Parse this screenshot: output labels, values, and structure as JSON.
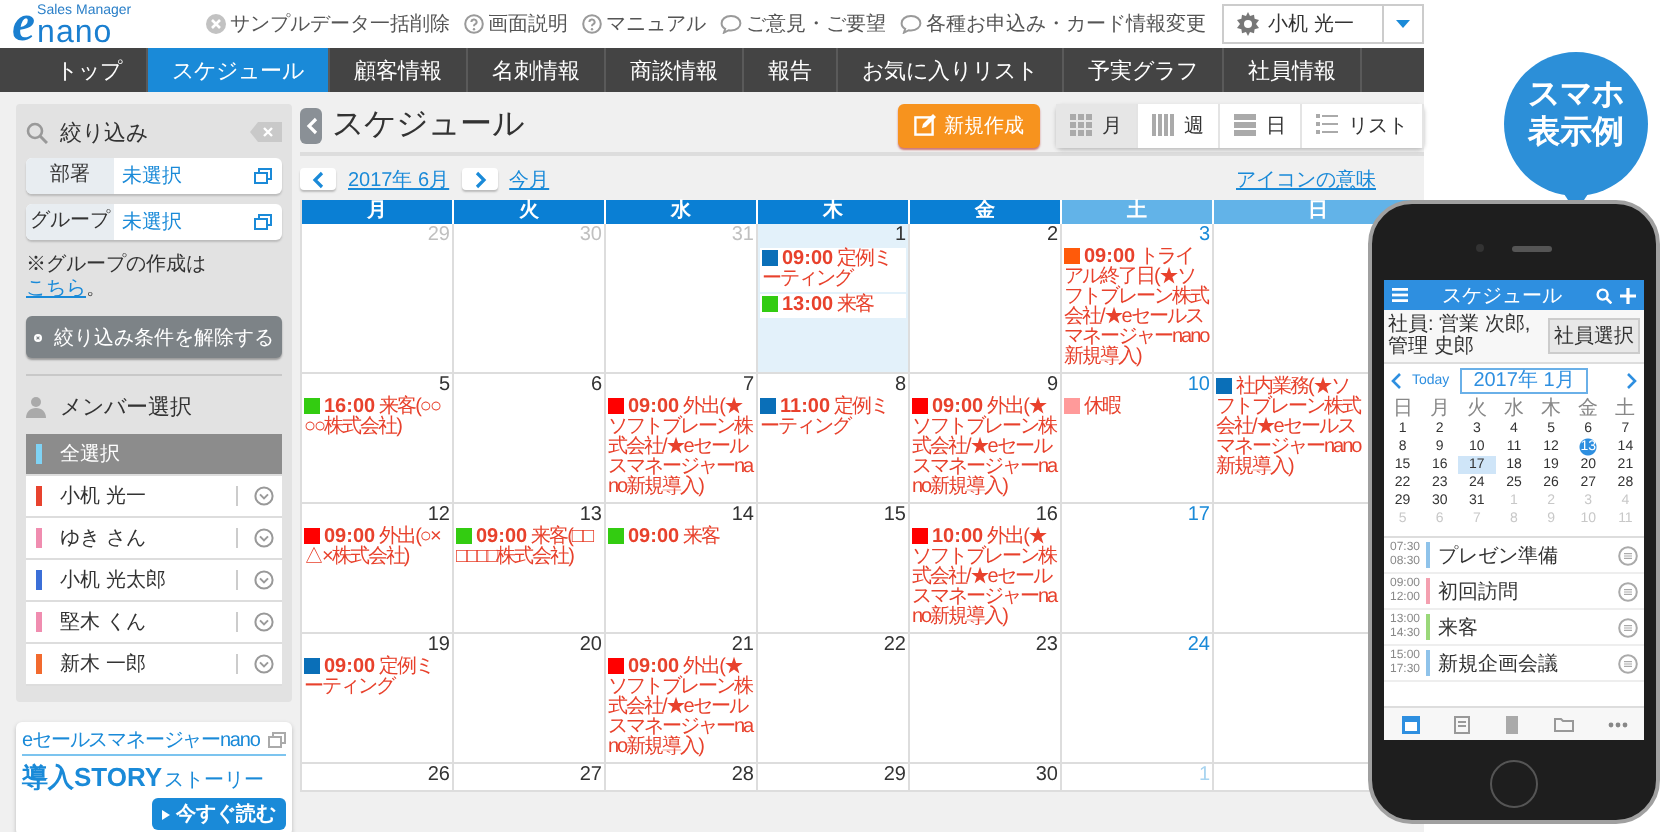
{
  "header": {
    "logo": {
      "mark": "e",
      "name": "nano",
      "tagline": "Sales Manager"
    },
    "links": [
      {
        "kind": "delete",
        "label": "サンプルデータ一括削除"
      },
      {
        "kind": "help",
        "label": "画面説明"
      },
      {
        "kind": "help",
        "label": "マニュアル"
      },
      {
        "kind": "comment",
        "label": "ご意見・ご要望"
      },
      {
        "kind": "comment",
        "label": "各種お申込み・カード情報変更"
      }
    ],
    "user": "小机 光一"
  },
  "nav": [
    {
      "label": "トップ",
      "selected": false
    },
    {
      "label": "スケジュール",
      "selected": true
    },
    {
      "label": "顧客情報",
      "selected": false
    },
    {
      "label": "名刺情報",
      "selected": false
    },
    {
      "label": "商談情報",
      "selected": false
    },
    {
      "label": "報告",
      "selected": false
    },
    {
      "label": "お気に入りリスト",
      "selected": false
    },
    {
      "label": "予実グラフ",
      "selected": false
    },
    {
      "label": "社員情報",
      "selected": false
    }
  ],
  "sidebar": {
    "filter": {
      "title": "絞り込み",
      "fields": [
        {
          "label": "部署",
          "value": "未選択"
        },
        {
          "label": "グループ",
          "value": "未選択"
        }
      ],
      "note": "※グループの作成は",
      "note_link": "こちら",
      "note_end": "。",
      "clear_button": "絞り込み条件を解除する"
    },
    "members": {
      "title": "メンバー選択",
      "items": [
        {
          "kind": "all",
          "name": "全選択",
          "color": "#7fd3f5"
        },
        {
          "kind": "member",
          "name": "小机 光一",
          "color": "#e8432e"
        },
        {
          "kind": "member",
          "name": "ゆき さん",
          "color": "#f08db0"
        },
        {
          "kind": "member",
          "name": "小机 光太郎",
          "color": "#3b6fd8"
        },
        {
          "kind": "member",
          "name": "堅木 くん",
          "color": "#f08db0"
        },
        {
          "kind": "member",
          "name": "新木 一郎",
          "color": "#f26a2e"
        }
      ]
    },
    "banner": {
      "caption": "eセールスマネージャーnano",
      "title": "導入STORY",
      "title_sub": "ストーリー",
      "button": "今すぐ読む"
    }
  },
  "schedule": {
    "title": "スケジュール",
    "new_button": "新規作成",
    "views": [
      {
        "kind": "month",
        "label": "月",
        "selected": true
      },
      {
        "kind": "week",
        "label": "週",
        "selected": false
      },
      {
        "kind": "day",
        "label": "日",
        "selected": false
      },
      {
        "kind": "list",
        "label": "リスト",
        "selected": false
      }
    ],
    "month": "2017年 6月",
    "this_month": "今月",
    "legend_link": "アイコンの意味",
    "columns": [
      {
        "label": "月",
        "kind": "weekday"
      },
      {
        "label": "火",
        "kind": "weekday"
      },
      {
        "label": "水",
        "kind": "weekday"
      },
      {
        "label": "木",
        "kind": "weekday"
      },
      {
        "label": "金",
        "kind": "weekday"
      },
      {
        "label": "土",
        "kind": "saturday"
      },
      {
        "label": "日",
        "kind": "sunday"
      }
    ],
    "weeks": [
      [
        {
          "day": "29",
          "kind": "outside"
        },
        {
          "day": "30",
          "kind": "outside"
        },
        {
          "day": "31",
          "kind": "outside"
        },
        {
          "day": "1",
          "kind": "today",
          "events": [
            {
              "time": "09:00",
              "text": "定例ミーティング",
              "color": "#0a6fb8"
            },
            {
              "time": "13:00",
              "text": "来客",
              "color": "#33cc11"
            }
          ]
        },
        {
          "day": "2",
          "kind": "normal"
        },
        {
          "day": "3",
          "kind": "normal",
          "events": [
            {
              "time": "09:00",
              "text": "トライアル終了日(★ソフトブレーン株式会社/★eセールスマネージャーnano新規導入)",
              "color": "#ff5a0a"
            }
          ]
        },
        {
          "kind": "normal"
        }
      ],
      [
        {
          "day": "5",
          "kind": "normal",
          "events": [
            {
              "time": "16:00",
              "text": "来客(○○○○株式会社)",
              "color": "#33cc11"
            }
          ]
        },
        {
          "day": "6",
          "kind": "normal"
        },
        {
          "day": "7",
          "kind": "normal",
          "events": [
            {
              "time": "09:00",
              "text": "外出(★ソフトブレーン株式会社/★eセールスマネージャーnano新規導入)",
              "color": "#ff0000"
            }
          ]
        },
        {
          "day": "8",
          "kind": "normal",
          "events": [
            {
              "time": "11:00",
              "text": "定例ミーティング",
              "color": "#0a6fb8"
            }
          ]
        },
        {
          "day": "9",
          "kind": "normal",
          "events": [
            {
              "time": "09:00",
              "text": "外出(★ソフトブレーン株式会社/★eセールスマネージャーnano新規導入)",
              "color": "#ff0000"
            }
          ]
        },
        {
          "day": "10",
          "kind": "normal",
          "events": [
            {
              "text": "休暇",
              "color": "#ff9a9a"
            }
          ]
        },
        {
          "kind": "normal",
          "events": [
            {
              "text": "社内業務(★ソフトブレーン株式会社/★eセールスマネージャーnano新規導入)",
              "color": "#0a6fb8"
            }
          ]
        }
      ],
      [
        {
          "day": "12",
          "kind": "normal",
          "events": [
            {
              "time": "09:00",
              "text": "外出(○×△×株式会社)",
              "color": "#ff0000"
            }
          ]
        },
        {
          "day": "13",
          "kind": "normal",
          "events": [
            {
              "time": "09:00",
              "text": "来客(□□□□□□株式会社)",
              "color": "#33cc11"
            }
          ]
        },
        {
          "day": "14",
          "kind": "normal",
          "events": [
            {
              "time": "09:00",
              "text": "来客",
              "color": "#33cc11"
            }
          ]
        },
        {
          "day": "15",
          "kind": "normal"
        },
        {
          "day": "16",
          "kind": "normal",
          "events": [
            {
              "time": "10:00",
              "text": "外出(★ソフトブレーン株式会社/★eセールスマネージャーnano新規導入)",
              "color": "#ff0000"
            }
          ]
        },
        {
          "day": "17",
          "kind": "normal"
        },
        {
          "kind": "normal"
        }
      ],
      [
        {
          "day": "19",
          "kind": "normal",
          "events": [
            {
              "time": "09:00",
              "text": "定例ミーティング",
              "color": "#0a6fb8"
            }
          ]
        },
        {
          "day": "20",
          "kind": "normal"
        },
        {
          "day": "21",
          "kind": "normal",
          "events": [
            {
              "time": "09:00",
              "text": "外出(★ソフトブレーン株式会社/★eセールスマネージャーnano新規導入)",
              "color": "#ff0000"
            }
          ]
        },
        {
          "day": "22",
          "kind": "normal"
        },
        {
          "day": "23",
          "kind": "normal"
        },
        {
          "day": "24",
          "kind": "normal"
        },
        {
          "kind": "normal"
        }
      ],
      [
        {
          "day": "26",
          "kind": "normal"
        },
        {
          "day": "27",
          "kind": "normal"
        },
        {
          "day": "28",
          "kind": "normal"
        },
        {
          "day": "29",
          "kind": "normal"
        },
        {
          "day": "30",
          "kind": "normal"
        },
        {
          "day": "1",
          "kind": "outside"
        },
        {
          "kind": "normal"
        }
      ]
    ]
  },
  "bubble": "スマホ表示例",
  "phone": {
    "title": "スケジュール",
    "staff": "社員: 営業 次郎,管理 史郎",
    "staff_button": "社員選択",
    "today": "Today",
    "month": "2017年 1月",
    "weekdays": [
      "日",
      "月",
      "火",
      "水",
      "木",
      "金",
      "土"
    ],
    "weeks": [
      [
        {
          "day": "1",
          "kind": "normal"
        },
        {
          "day": "2",
          "kind": "normal"
        },
        {
          "day": "3",
          "kind": "normal"
        },
        {
          "day": "4",
          "kind": "normal"
        },
        {
          "day": "5",
          "kind": "normal"
        },
        {
          "day": "6",
          "kind": "normal"
        },
        {
          "day": "7",
          "kind": "normal"
        }
      ],
      [
        {
          "day": "8",
          "kind": "normal"
        },
        {
          "day": "9",
          "kind": "normal"
        },
        {
          "day": "10",
          "kind": "normal"
        },
        {
          "day": "11",
          "kind": "normal"
        },
        {
          "day": "12",
          "kind": "normal"
        },
        {
          "day": "13",
          "kind": "today"
        },
        {
          "day": "14",
          "kind": "normal"
        }
      ],
      [
        {
          "day": "15",
          "kind": "normal"
        },
        {
          "day": "16",
          "kind": "normal"
        },
        {
          "day": "17",
          "kind": "selected"
        },
        {
          "day": "18",
          "kind": "normal"
        },
        {
          "day": "19",
          "kind": "normal"
        },
        {
          "day": "20",
          "kind": "normal"
        },
        {
          "day": "21",
          "kind": "normal"
        }
      ],
      [
        {
          "day": "22",
          "kind": "normal"
        },
        {
          "day": "23",
          "kind": "normal"
        },
        {
          "day": "24",
          "kind": "normal"
        },
        {
          "day": "25",
          "kind": "normal"
        },
        {
          "day": "26",
          "kind": "normal"
        },
        {
          "day": "27",
          "kind": "normal"
        },
        {
          "day": "28",
          "kind": "normal"
        }
      ],
      [
        {
          "day": "29",
          "kind": "normal"
        },
        {
          "day": "30",
          "kind": "normal"
        },
        {
          "day": "31",
          "kind": "normal"
        },
        {
          "day": "1",
          "kind": "outside"
        },
        {
          "day": "2",
          "kind": "outside"
        },
        {
          "day": "3",
          "kind": "outside"
        },
        {
          "day": "4",
          "kind": "outside"
        }
      ],
      [
        {
          "day": "5",
          "kind": "outside"
        },
        {
          "day": "6",
          "kind": "outside"
        },
        {
          "day": "7",
          "kind": "outside"
        },
        {
          "day": "8",
          "kind": "outside"
        },
        {
          "day": "9",
          "kind": "outside"
        },
        {
          "day": "10",
          "kind": "outside"
        },
        {
          "day": "11",
          "kind": "outside"
        }
      ]
    ],
    "events": [
      {
        "start": "07:30",
        "end": "08:30",
        "title": "プレゼン準備",
        "color": "#8fc3ea"
      },
      {
        "start": "09:00",
        "end": "12:00",
        "title": "初回訪問",
        "color": "#f4a0b0"
      },
      {
        "start": "13:00",
        "end": "14:30",
        "title": "来客",
        "color": "#9ad87a"
      },
      {
        "start": "15:00",
        "end": "17:30",
        "title": "新規企画会議",
        "color": "#8fc3ea"
      }
    ]
  }
}
